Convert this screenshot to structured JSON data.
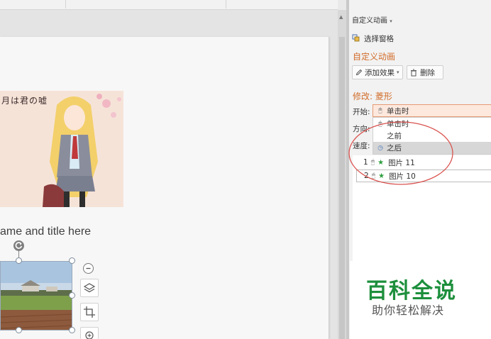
{
  "slide": {
    "anime_title": "月は君の嘘",
    "subtitle": "ame and title here"
  },
  "task_pane": {
    "title": "自定义动画",
    "title_arrow": "▾",
    "select_pane_label": "选择窗格",
    "section_title": "自定义动画",
    "add_effect_label": "添加效果",
    "add_effect_arrow": "▾",
    "delete_label": "删除",
    "modify_title": "修改: 菱形",
    "start_label": "开始:",
    "start_value": "单击时",
    "direction_label": "方向:",
    "speed_label": "速度:",
    "dropdown_options": [
      {
        "label": "单击时",
        "icon": "mouse-icon",
        "selected": false
      },
      {
        "label": "之前",
        "icon": "",
        "selected": false
      },
      {
        "label": "之后",
        "icon": "clock-icon",
        "selected": true
      }
    ],
    "animations": [
      {
        "index": "1",
        "name": "图片 11"
      },
      {
        "index": "2",
        "name": "图片 10"
      }
    ]
  },
  "watermark": {
    "big": "百科全说",
    "small": "助你轻松解决"
  },
  "colors": {
    "accent": "#d16d2b",
    "star": "#2e9e3e",
    "annotation": "#d9534f",
    "watermark_green": "#1d8f3c"
  }
}
